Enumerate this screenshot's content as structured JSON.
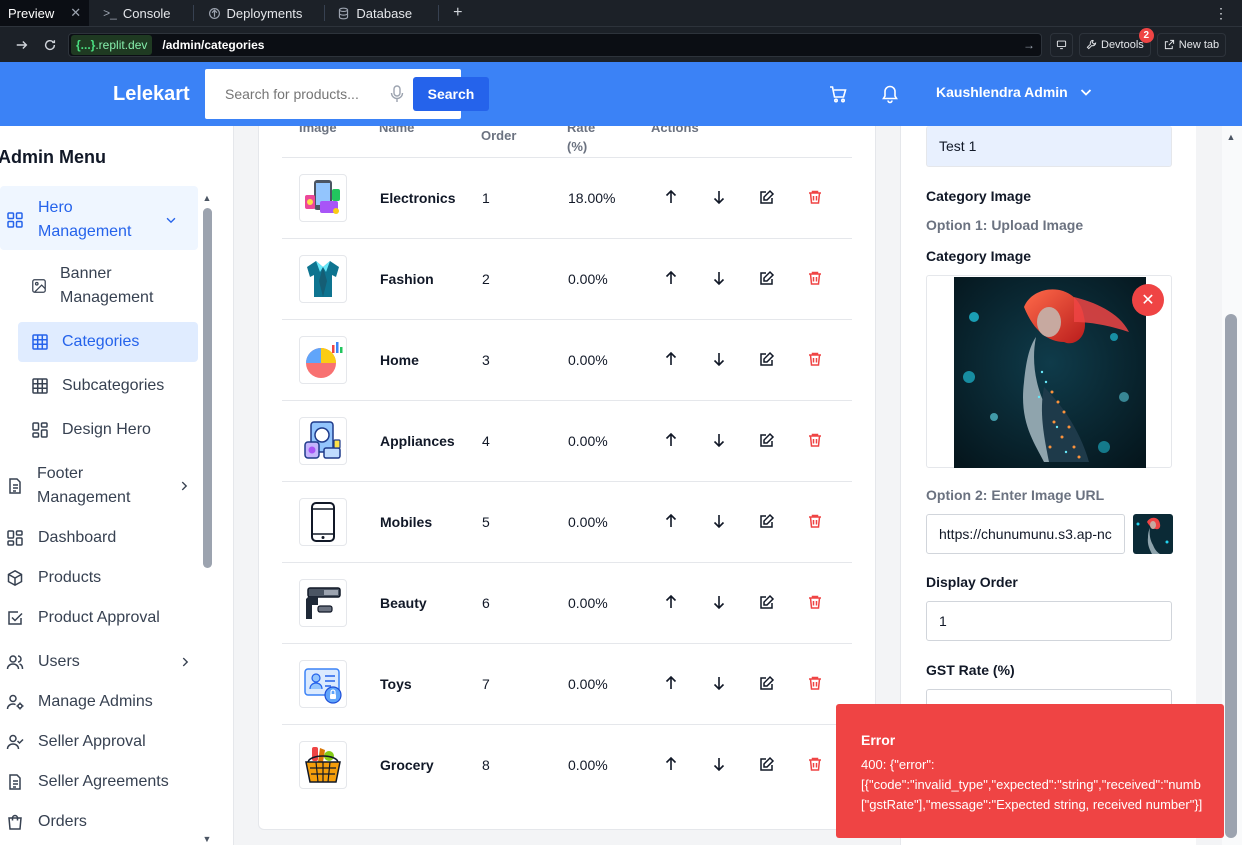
{
  "browser": {
    "tabs": [
      {
        "label": "Preview",
        "active": true
      },
      {
        "label": "Console"
      },
      {
        "label": "Deployments"
      },
      {
        "label": "Database"
      }
    ],
    "url_host_prefix": "{...}",
    "url_host": ".replit.dev",
    "url_path": "/admin/categories",
    "devtools_label": "Devtools",
    "devtools_badge": "2",
    "newtab_label": "New tab"
  },
  "header": {
    "brand": "Lelekart",
    "search_placeholder": "Search for products...",
    "search_button": "Search",
    "user_name": "Kaushlendra Admin",
    "accent_color": "#3b82f6"
  },
  "sidebar": {
    "title": "Admin Menu",
    "hero_management": "Hero Management",
    "hero_sub": [
      "Banner Management",
      "Categories",
      "Subcategories",
      "Design Hero"
    ],
    "items": [
      "Footer Management",
      "Dashboard",
      "Products",
      "Product Approval",
      "Users",
      "Manage Admins",
      "Seller Approval",
      "Seller Agreements",
      "Orders"
    ]
  },
  "table": {
    "headers": {
      "image": "Image",
      "name": "Name",
      "order": "Order",
      "rate": "Rate",
      "rate_unit": "(%)",
      "actions": "Actions"
    },
    "rows": [
      {
        "name": "Electronics",
        "order": "1",
        "rate": "18.00%",
        "icon": "electronics-icon"
      },
      {
        "name": "Fashion",
        "order": "2",
        "rate": "0.00%",
        "icon": "fashion-icon"
      },
      {
        "name": "Home",
        "order": "3",
        "rate": "0.00%",
        "icon": "home-chart-icon"
      },
      {
        "name": "Appliances",
        "order": "4",
        "rate": "0.00%",
        "icon": "appliances-icon"
      },
      {
        "name": "Mobiles",
        "order": "5",
        "rate": "0.00%",
        "icon": "mobile-icon"
      },
      {
        "name": "Beauty",
        "order": "6",
        "rate": "0.00%",
        "icon": "beauty-icon"
      },
      {
        "name": "Toys",
        "order": "7",
        "rate": "0.00%",
        "icon": "toys-icon"
      },
      {
        "name": "Grocery",
        "order": "8",
        "rate": "0.00%",
        "icon": "grocery-icon"
      }
    ]
  },
  "form": {
    "name_value": "Test 1",
    "category_image_label": "Category Image",
    "option1_label": "Option 1: Upload Image",
    "category_image_label2": "Category Image",
    "option2_label": "Option 2: Enter Image URL",
    "image_url_value": "https://chunumunu.s3.ap-nc",
    "display_order_label": "Display Order",
    "display_order_value": "1",
    "gst_rate_label": "GST Rate (%)"
  },
  "toast": {
    "title": "Error",
    "message": "400: {\"error\":\n[{\"code\":\"invalid_type\",\"expected\":\"string\",\"received\":\"numb\n[\"gstRate\"],\"message\":\"Expected string, received number\"}]",
    "color": "#ef4444"
  }
}
